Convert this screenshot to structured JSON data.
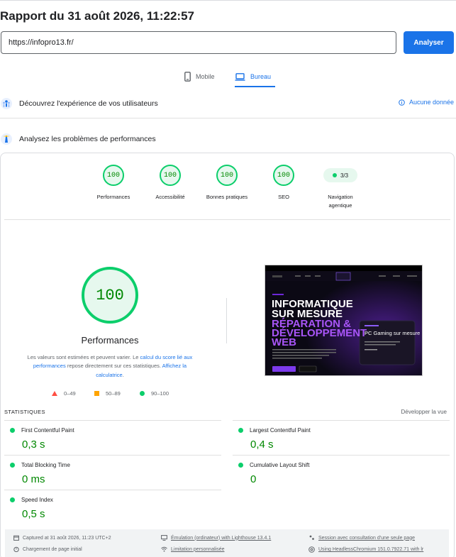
{
  "title": "Rapport du 31 août 2026, 11:22:57",
  "url_input": {
    "value": "https://infopro13.fr/"
  },
  "analyze_button": "Analyser",
  "tabs": [
    {
      "label": "Mobile",
      "icon": "phone-icon",
      "active": false
    },
    {
      "label": "Bureau",
      "icon": "laptop-icon",
      "active": true
    }
  ],
  "crux": {
    "heading": "Découvrez l'expérience de vos utilisateurs",
    "status": "Aucune donnée"
  },
  "perf_section": {
    "heading": "Analysez les problèmes de performances"
  },
  "scores": [
    {
      "label": "Performances",
      "score": "100"
    },
    {
      "label": "Accessibilité",
      "score": "100"
    },
    {
      "label": "Bonnes pratiques",
      "score": "100"
    },
    {
      "label": "SEO",
      "score": "100"
    }
  ],
  "navigation": {
    "value": "3/3",
    "label_line1": "Navigation",
    "label_line2": "agentique"
  },
  "main_gauge": {
    "score": "100",
    "label": "Performances"
  },
  "note": {
    "part1": "Les valeurs sont estimées et peuvent varier. Le ",
    "link1": "calcul du score lié aux performances",
    "part2": " repose directement sur ces statistiques. ",
    "link2": "Affichez la calculatrice",
    "part3": "."
  },
  "legend": [
    {
      "range": "0–49",
      "color": "#ff4e42"
    },
    {
      "range": "50–89",
      "color": "#ffa400"
    },
    {
      "range": "90–100",
      "color": "#0cce6b"
    }
  ],
  "screenshot": {
    "heading_line1": "INFORMATIQUE",
    "heading_line2": "SUR MESURE",
    "heading_line3": "RÉPARATION &",
    "heading_line4": "DÉVELOPPEMENT",
    "heading_line5": "WEB",
    "card_title": "PC Gaming sur mesure"
  },
  "stats": {
    "heading": "STATISTIQUES",
    "expand": "Développer la vue",
    "metrics": [
      {
        "name": "First Contentful Paint",
        "value": "0,3 s"
      },
      {
        "name": "Largest Contentful Paint",
        "value": "0,4 s"
      },
      {
        "name": "Total Blocking Time",
        "value": "0 ms"
      },
      {
        "name": "Cumulative Layout Shift",
        "value": "0"
      },
      {
        "name": "Speed Index",
        "value": "0,5 s"
      }
    ]
  },
  "footer": {
    "captured": "Captured at 31 août 2026, 11:23 UTC+2",
    "load": "Chargement de page initial",
    "emulation": "Émulation (ordinateur) with Lighthouse 13.4.1",
    "throttling": "Limitation personnalisée",
    "session": "Session avec consultation d'une seule page",
    "browser": "Using HeadlessChromium 151.0.7922.71 with lr"
  }
}
